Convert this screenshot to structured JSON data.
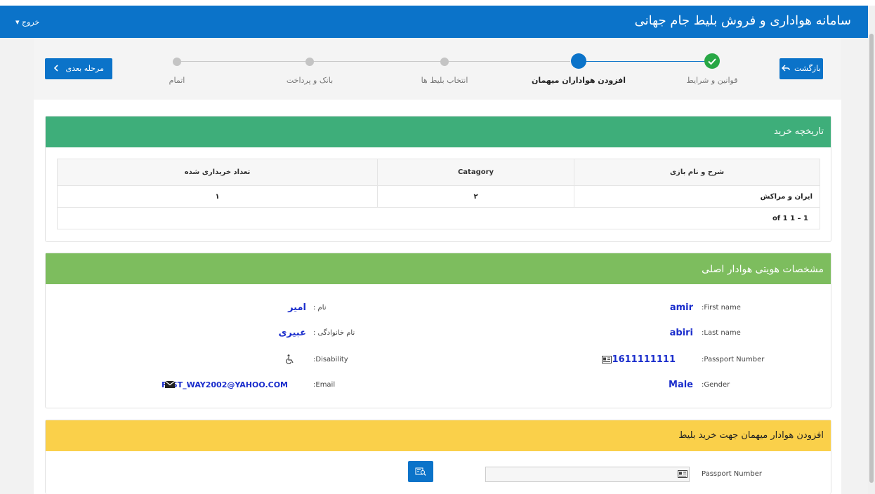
{
  "header": {
    "title": "سامانه هواداری و فروش بلیط جام جهانی",
    "logout_label": "خروج ▾"
  },
  "nav": {
    "back_label": "بازگشت",
    "next_label": "مرحله بعدی"
  },
  "steps": [
    {
      "label": "قوانین و شرایط",
      "status": "done"
    },
    {
      "label": "افزودن هواداران میهمان",
      "status": "active"
    },
    {
      "label": "انتخاب بلیط ها",
      "status": "pending"
    },
    {
      "label": "بانک و پرداخت",
      "status": "pending"
    },
    {
      "label": "اتمام",
      "status": "pending"
    }
  ],
  "history": {
    "title": "تاریخچه خرید",
    "columns": [
      "شرح و نام بازی",
      "Catagory",
      "تعداد خریداری شده"
    ],
    "rows": [
      {
        "name": "ایران و مراکش",
        "category": "۲",
        "count": "۱"
      }
    ],
    "pager": "1 – 1 of 1"
  },
  "identity": {
    "title": "مشخصات هویتی هوادار اصلی",
    "first_name_label": ":First name",
    "first_name": "amir",
    "last_name_label": ":Last name",
    "last_name": "abiri",
    "passport_label": ":Passport Number",
    "passport": "1611111111",
    "gender_label": ":Gender",
    "gender": "Male",
    "name_fa_label": "نام :",
    "name_fa": "امیر",
    "family_fa_label": "نام خانوادگی :",
    "family_fa": "عبیری",
    "disability_label": ":Disability",
    "email_label": ":Email",
    "email": "FAST_WAY2002@YAHOO.COM"
  },
  "guest": {
    "title": "افزودن هوادار میهمان جهت خرید بلیط",
    "passport_label": "Passport Number",
    "passport_value": ""
  },
  "colors": {
    "brand": "#0b73c9",
    "history": "#3eae7a",
    "identity": "#7dbd5e",
    "guest": "#fad04a",
    "value": "#1a2dcc"
  },
  "icons": {
    "back": "reply-icon",
    "next": "chevron-left-icon",
    "passport": "id-card-icon",
    "email": "envelope-icon",
    "disability": "wheelchair-icon",
    "search": "search-id-icon"
  }
}
